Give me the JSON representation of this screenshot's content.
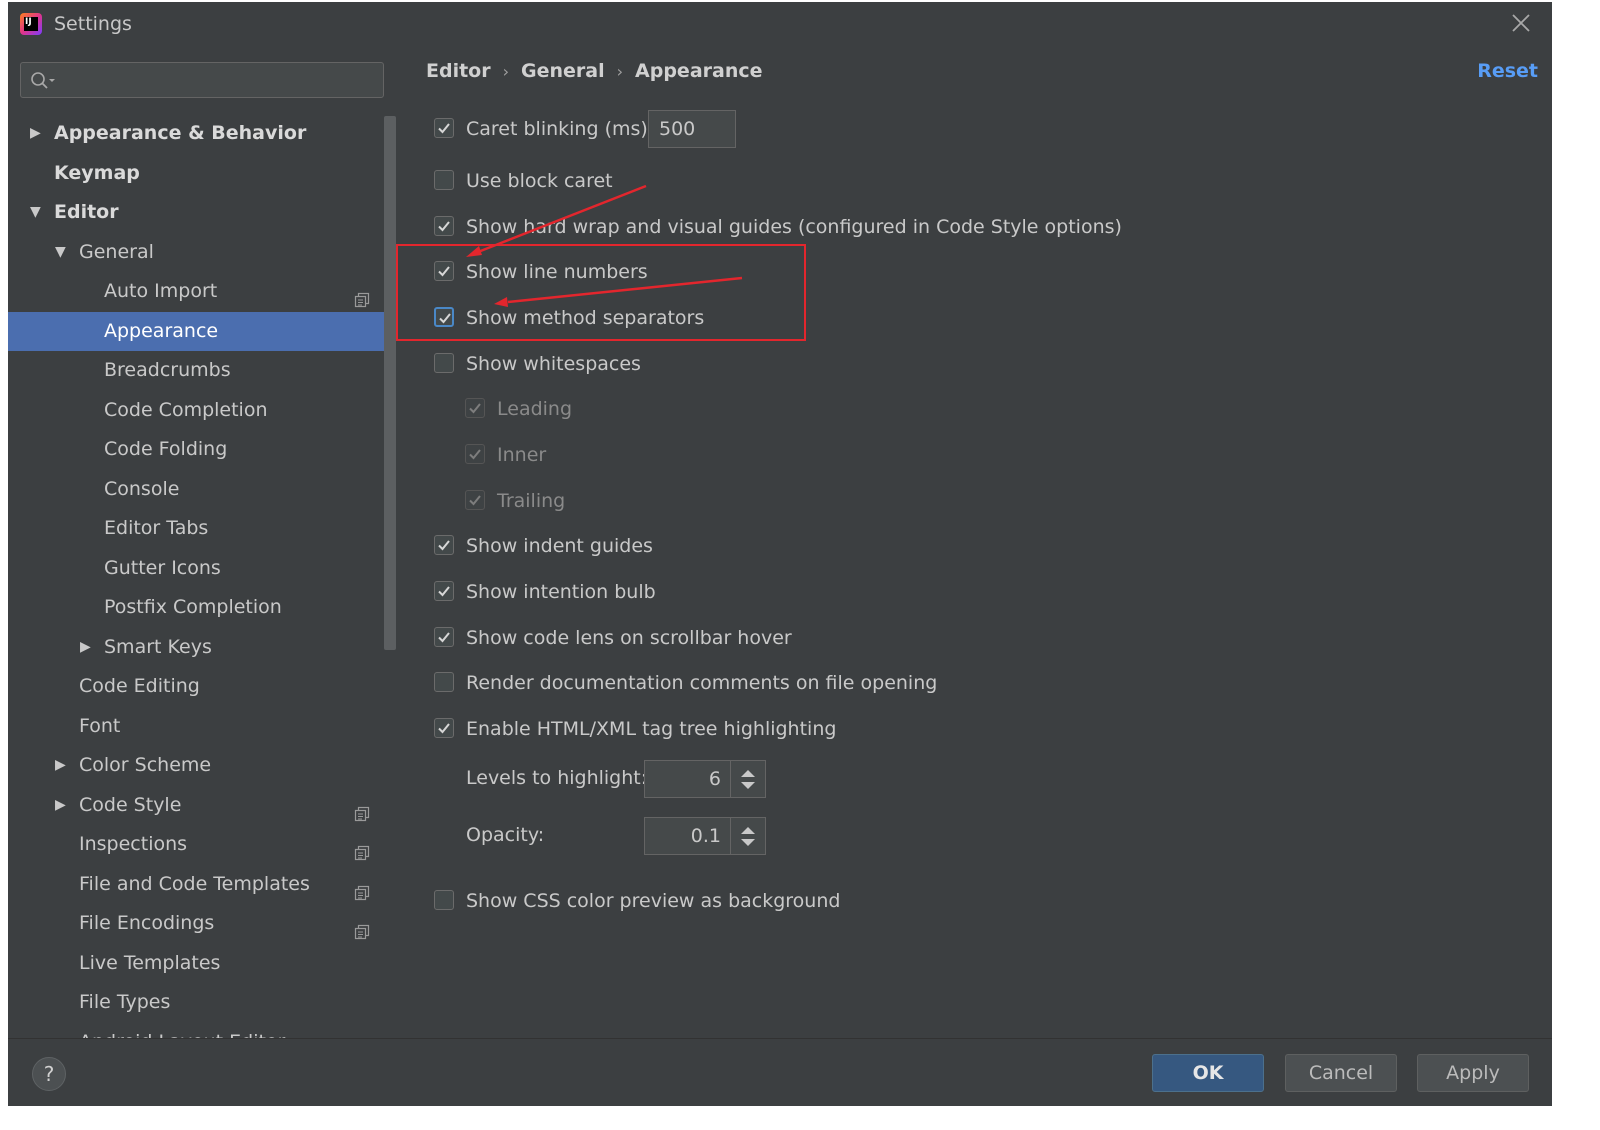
{
  "window": {
    "title": "Settings"
  },
  "search": {
    "placeholder": "",
    "value": ""
  },
  "sidebar": {
    "items": [
      {
        "label": "Appearance & Behavior",
        "level": 0,
        "expander": "collapsed",
        "bold": true
      },
      {
        "label": "Keymap",
        "level": 0,
        "expander": "none",
        "bold": true
      },
      {
        "label": "Editor",
        "level": 0,
        "expander": "expanded",
        "bold": true
      },
      {
        "label": "General",
        "level": 1,
        "expander": "expanded"
      },
      {
        "label": "Auto Import",
        "level": 2,
        "expander": "none",
        "project_icon": true
      },
      {
        "label": "Appearance",
        "level": 2,
        "expander": "none",
        "selected": true
      },
      {
        "label": "Breadcrumbs",
        "level": 2,
        "expander": "none"
      },
      {
        "label": "Code Completion",
        "level": 2,
        "expander": "none"
      },
      {
        "label": "Code Folding",
        "level": 2,
        "expander": "none"
      },
      {
        "label": "Console",
        "level": 2,
        "expander": "none"
      },
      {
        "label": "Editor Tabs",
        "level": 2,
        "expander": "none"
      },
      {
        "label": "Gutter Icons",
        "level": 2,
        "expander": "none"
      },
      {
        "label": "Postfix Completion",
        "level": 2,
        "expander": "none"
      },
      {
        "label": "Smart Keys",
        "level": 2,
        "expander": "collapsed"
      },
      {
        "label": "Code Editing",
        "level": 1,
        "expander": "none"
      },
      {
        "label": "Font",
        "level": 1,
        "expander": "none"
      },
      {
        "label": "Color Scheme",
        "level": 1,
        "expander": "collapsed"
      },
      {
        "label": "Code Style",
        "level": 1,
        "expander": "collapsed",
        "project_icon": true
      },
      {
        "label": "Inspections",
        "level": 1,
        "expander": "none",
        "project_icon": true
      },
      {
        "label": "File and Code Templates",
        "level": 1,
        "expander": "none",
        "project_icon": true
      },
      {
        "label": "File Encodings",
        "level": 1,
        "expander": "none",
        "project_icon": true
      },
      {
        "label": "Live Templates",
        "level": 1,
        "expander": "none"
      },
      {
        "label": "File Types",
        "level": 1,
        "expander": "none"
      },
      {
        "label": "Android Layout Editor",
        "level": 1,
        "expander": "none"
      }
    ]
  },
  "breadcrumb": {
    "part1": "Editor",
    "part2": "General",
    "part3": "Appearance",
    "separator": "›"
  },
  "reset_label": "Reset",
  "options": {
    "caret_blinking": {
      "label": "Caret blinking (ms):",
      "checked": true,
      "value": "500"
    },
    "block_caret": {
      "label": "Use block caret",
      "checked": false
    },
    "hard_wrap": {
      "label": "Show hard wrap and visual guides (configured in Code Style options)",
      "checked": true
    },
    "line_numbers": {
      "label": "Show line numbers",
      "checked": true
    },
    "method_separators": {
      "label": "Show method separators",
      "checked": true
    },
    "whitespaces": {
      "label": "Show whitespaces",
      "checked": false
    },
    "leading": {
      "label": "Leading",
      "checked": true,
      "disabled": true
    },
    "inner": {
      "label": "Inner",
      "checked": true,
      "disabled": true
    },
    "trailing": {
      "label": "Trailing",
      "checked": true,
      "disabled": true
    },
    "indent_guides": {
      "label": "Show indent guides",
      "checked": true
    },
    "intention_bulb": {
      "label": "Show intention bulb",
      "checked": true
    },
    "code_lens": {
      "label": "Show code lens on scrollbar hover",
      "checked": true
    },
    "render_docs": {
      "label": "Render documentation comments on file opening",
      "checked": false
    },
    "tag_tree": {
      "label": "Enable HTML/XML tag tree highlighting",
      "checked": true
    },
    "levels": {
      "label": "Levels to highlight:",
      "value": "6"
    },
    "opacity": {
      "label": "Opacity:",
      "value": "0.1"
    },
    "css_preview": {
      "label": "Show CSS color preview as background",
      "checked": false
    }
  },
  "footer": {
    "help": "?",
    "ok": "OK",
    "cancel": "Cancel",
    "apply": "Apply"
  },
  "colors": {
    "background": "#3c3f41",
    "selection": "#4b6eaf",
    "link": "#589df6",
    "annotation": "#e3262d",
    "primary_button": "#365880"
  },
  "icons": {
    "close": "close-icon",
    "search": "search-icon",
    "help": "help-icon",
    "project": "project-scope-icon"
  }
}
